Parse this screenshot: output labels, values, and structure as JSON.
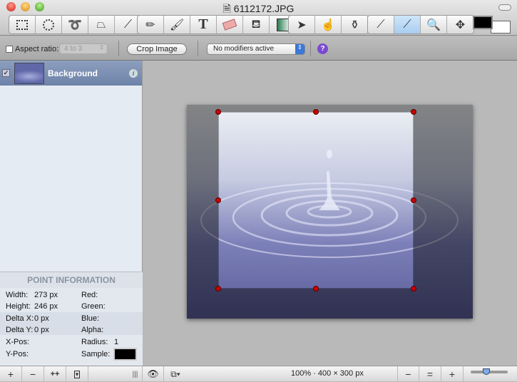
{
  "window": {
    "title": "6112172.JPG"
  },
  "toolbar": {
    "groups": [
      [
        "rect-select-icon",
        "ellipse-select-icon",
        "lasso-icon",
        "polygon-lasso-icon",
        "magic-wand-icon"
      ],
      [
        "pencil-icon",
        "brush-icon",
        "text-icon",
        "eraser-icon",
        "paint-bucket-icon",
        "gradient-icon"
      ],
      [
        "pointer-icon",
        "hand-icon",
        "stamp-icon"
      ],
      [
        "eyedropper-icon",
        "crop-scalpel-icon",
        "magnifier-icon",
        "move-icon"
      ]
    ],
    "text_tool_glyph": "T",
    "active_tool": "crop-scalpel-icon",
    "foreground_color": "#000000",
    "background_color": "#ffffff"
  },
  "options": {
    "aspect_label": "Aspect ratio:",
    "aspect_value": "4 to 3",
    "crop_button": "Crop Image",
    "modifiers": "No modifiers active",
    "help": "?"
  },
  "layers": [
    {
      "name": "Background",
      "visible": true
    }
  ],
  "point_info": {
    "header": "POINT INFORMATION",
    "width_label": "Width:",
    "width": "273 px",
    "height_label": "Height:",
    "height": "246 px",
    "dx_label": "Delta X:",
    "dx": "0 px",
    "dy_label": "Delta Y:",
    "dy": "0 px",
    "xpos_label": "X-Pos:",
    "ypos_label": "Y-Pos:",
    "red": "Red:",
    "green": "Green:",
    "blue": "Blue:",
    "alpha": "Alpha:",
    "radius_label": "Radius:",
    "radius": "1",
    "sample_label": "Sample:",
    "sample_color": "#000000"
  },
  "sidebar_bottom": {
    "add": "+",
    "remove": "−",
    "duplicate": "++",
    "menu": "▾",
    "grip": "|||"
  },
  "status": {
    "zoom_info": "100% · 400 × 300 px",
    "zoom_out": "−",
    "zoom_actual": "=",
    "zoom_in": "+"
  }
}
